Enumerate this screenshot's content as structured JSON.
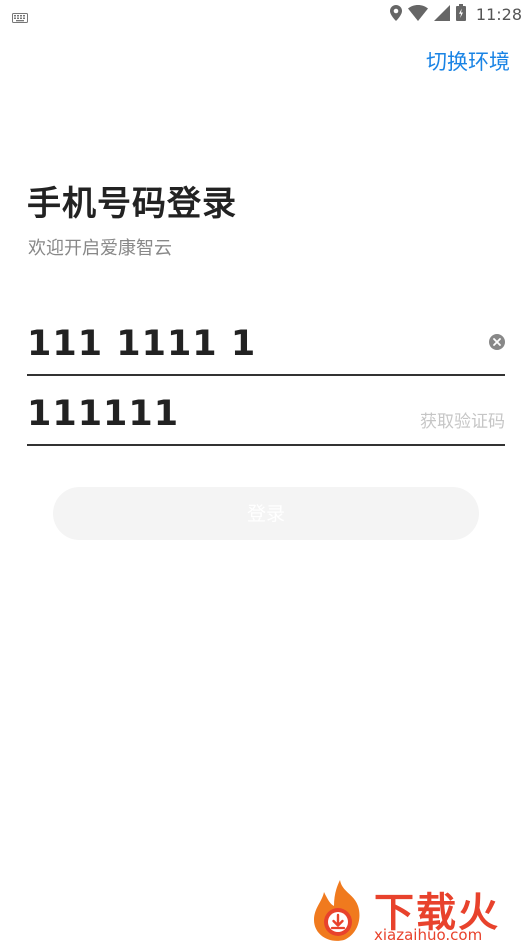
{
  "status_bar": {
    "time": "11:28",
    "icons": [
      "keyboard-icon",
      "location-icon",
      "wifi-icon",
      "signal-icon",
      "battery-icon"
    ]
  },
  "header": {
    "env_switch_label": "切换环境"
  },
  "main": {
    "title": "手机号码登录",
    "subtitle": "欢迎开启爱康智云",
    "phone_field": {
      "value": "111 1111 1"
    },
    "code_field": {
      "value": "111111",
      "get_code_label": "获取验证码"
    },
    "login_label": "登录"
  },
  "watermark": {
    "cn": "下载火",
    "en": "xiazaihuo.com"
  },
  "colors": {
    "accent": "#1a84e5",
    "watermark": "#e8422c",
    "disabled_button": "#f4f4f4"
  }
}
